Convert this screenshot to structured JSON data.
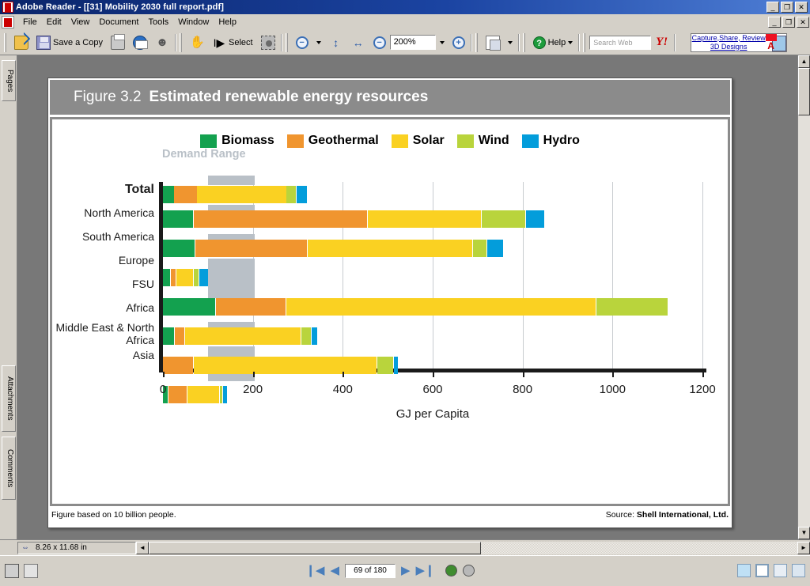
{
  "window": {
    "title": "Adobe Reader - [[31] Mobility 2030 full report.pdf]",
    "app_icon": "adobe-reader-icon",
    "min_label": "_",
    "restore_label": "❐",
    "close_label": "✕"
  },
  "menu": {
    "items": [
      {
        "label": "File"
      },
      {
        "label": "Edit"
      },
      {
        "label": "View"
      },
      {
        "label": "Document"
      },
      {
        "label": "Tools"
      },
      {
        "label": "Window"
      },
      {
        "label": "Help"
      }
    ],
    "min_label": "_",
    "restore_label": "❐",
    "close_label": "✕"
  },
  "toolbar": {
    "open_label": "",
    "save_label": "Save a Copy",
    "select_label": "Select",
    "zoom_value": "200%",
    "help_label": "Help",
    "search_placeholder": "Search Web",
    "yahoo_label": "Y!",
    "ad_line1": "Capture,Share, Review",
    "ad_line2": "3D Designs",
    "dropdown_caret": "▾"
  },
  "nav_rail": {
    "tabs": [
      {
        "label": "Pages"
      },
      {
        "label": "Attachments"
      },
      {
        "label": "Comments"
      }
    ]
  },
  "figure": {
    "number": "Figure 3.2",
    "title": "Estimated renewable energy resources",
    "footnote": "Figure based on 10 billion people.",
    "source_prefix": "Source:",
    "source_name": "Shell International, Ltd.",
    "demand_range_label": "Demand Range",
    "demand_range_color": "#b9c0c7"
  },
  "chart_data": {
    "type": "bar",
    "orientation": "horizontal",
    "stacked": true,
    "title": "Estimated renewable energy resources",
    "xlabel": "GJ per Capita",
    "ylabel": "",
    "xlim": [
      0,
      1200
    ],
    "xticks": [
      0,
      200,
      400,
      600,
      800,
      1000,
      1200
    ],
    "grid": "vertical",
    "legend_position": "top",
    "categories": [
      "Total",
      "North America",
      "South America",
      "Europe",
      "FSU",
      "Africa",
      "Middle East & North Africa",
      "Asia"
    ],
    "series": [
      {
        "name": "Biomass",
        "color": "#13a14f",
        "values": [
          25,
          66,
          70,
          18,
          118,
          26,
          0,
          10
        ]
      },
      {
        "name": "Geothermal",
        "color": "#f0952f",
        "values": [
          75,
          455,
          320,
          30,
          275,
          49,
          67,
          53
        ]
      },
      {
        "name": "Solar",
        "color": "#fad122",
        "values": [
          275,
          709,
          690,
          68,
          965,
          308,
          476,
          125
        ]
      },
      {
        "name": "Wind",
        "color": "#b9d43c",
        "values": [
          295,
          807,
          723,
          81,
          1124,
          331,
          513,
          132
        ]
      },
      {
        "name": "Hydro",
        "color": "#039ddb",
        "values": [
          317,
          849,
          758,
          100,
          1124,
          344,
          520,
          140
        ]
      }
    ],
    "series_note": "values are cumulative stacked ends in GJ per Capita",
    "demand_range": {
      "label": "Demand Range",
      "from": 100,
      "to": 205,
      "color": "#b9c0c7"
    }
  },
  "doc_status": {
    "page_size": "8.26 x 11.68 in",
    "left_arrow": "◄",
    "right_arrow": "►"
  },
  "status_bar": {
    "page_indicator": "69 of 180",
    "first_page": "❙◀",
    "prev_page": "◀",
    "next_page": "▶",
    "last_page": "▶❙",
    "prev_view": "◀",
    "next_view": "▶"
  }
}
